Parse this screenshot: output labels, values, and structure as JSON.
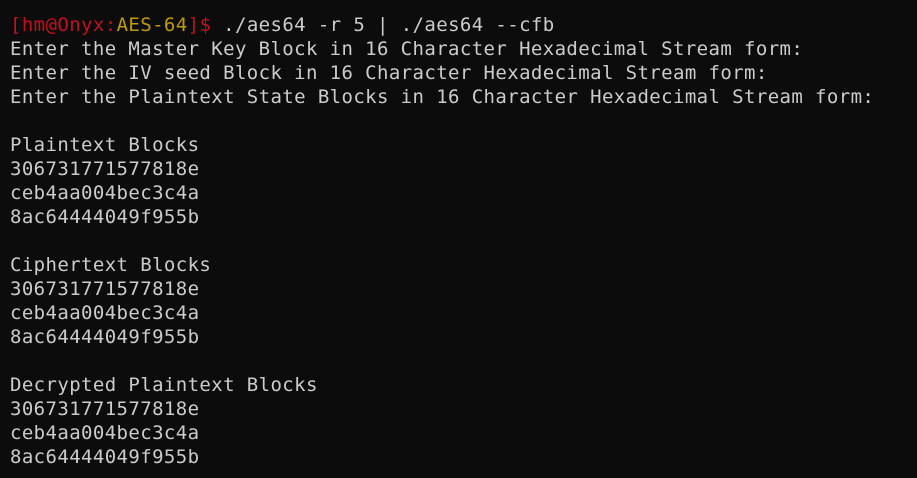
{
  "prompt": {
    "open_bracket": "[",
    "user_at": "hm@Onyx:",
    "cwd": "AES-64",
    "close_bracket": "]",
    "dollar": "$"
  },
  "command": " ./aes64 -r 5 | ./aes64 --cfb",
  "prompts_text": [
    "Enter the Master Key Block in 16 Character Hexadecimal Stream form:",
    "Enter the IV seed Block in 16 Character Hexadecimal Stream form:",
    "Enter the Plaintext State Blocks in 16 Character Hexadecimal Stream form:"
  ],
  "plaintext": {
    "header": "Plaintext Blocks",
    "blocks": [
      "306731771577818e",
      "ceb4aa004bec3c4a",
      "8ac64444049f955b"
    ]
  },
  "ciphertext": {
    "header": "Ciphertext Blocks",
    "blocks": [
      "306731771577818e",
      "ceb4aa004bec3c4a",
      "8ac64444049f955b"
    ]
  },
  "decrypted": {
    "header": "Decrypted Plaintext Blocks",
    "blocks": [
      "306731771577818e",
      "ceb4aa004bec3c4a",
      "8ac64444049f955b"
    ]
  },
  "colors": {
    "background": "#0c0c0c",
    "foreground": "#cccccc",
    "prompt_red": "#c50f1f",
    "prompt_yellow": "#c19c00"
  }
}
